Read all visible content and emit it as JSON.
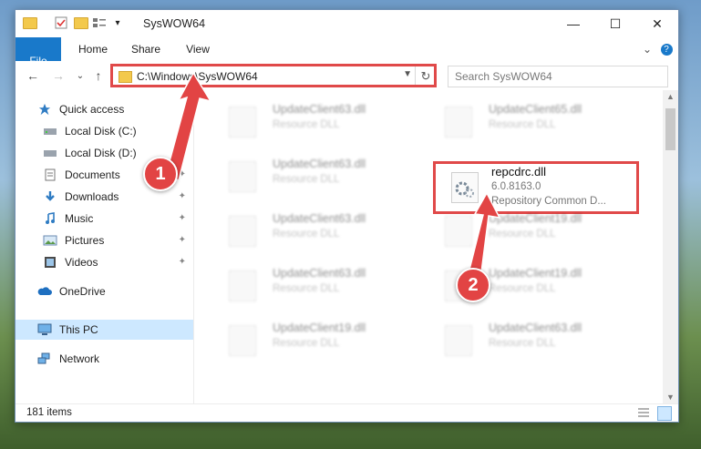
{
  "window": {
    "title": "SysWOW64",
    "minimize_glyph": "—",
    "maximize_glyph": "☐",
    "close_glyph": "✕"
  },
  "ribbon": {
    "tabs": [
      "File",
      "Home",
      "Share",
      "View"
    ],
    "expand_glyph": "⌄",
    "help_glyph": "?"
  },
  "navbar": {
    "back_glyph": "←",
    "forward_glyph": "→",
    "recent_glyph": "⌄",
    "up_glyph": "↑",
    "address": "C:\\Windows\\SysWOW64",
    "refresh_glyph": "↻",
    "search_placeholder": "Search SysWOW64"
  },
  "sidebar": {
    "items": [
      {
        "label": "Quick access",
        "icon": "star-icon",
        "pinned": false
      },
      {
        "label": "Local Disk (C:)",
        "icon": "drive-icon",
        "pinned": true
      },
      {
        "label": "Local Disk (D:)",
        "icon": "drive-icon",
        "pinned": true
      },
      {
        "label": "Documents",
        "icon": "documents-icon",
        "pinned": true
      },
      {
        "label": "Downloads",
        "icon": "downloads-icon",
        "pinned": true
      },
      {
        "label": "Music",
        "icon": "music-icon",
        "pinned": true
      },
      {
        "label": "Pictures",
        "icon": "pictures-icon",
        "pinned": true
      },
      {
        "label": "Videos",
        "icon": "videos-icon",
        "pinned": true
      },
      {
        "label": "OneDrive",
        "icon": "cloud-icon",
        "pinned": false
      },
      {
        "label": "This PC",
        "icon": "computer-icon",
        "pinned": false,
        "selected": true
      },
      {
        "label": "Network",
        "icon": "network-icon",
        "pinned": false
      }
    ],
    "pin_glyph": "📌"
  },
  "files": {
    "highlighted": {
      "name": "repcdrc.dll",
      "version": "6.0.8163.0",
      "description": "Repository Common D..."
    },
    "blurred": [
      {
        "name": "UpdateClient63.dll",
        "description": "Resource DLL"
      },
      {
        "name": "UpdateClient65.dll",
        "description": "Resource DLL"
      },
      {
        "name": "UpdateClient63.dll",
        "description": "Resource DLL"
      },
      {
        "name": "UpdateClient63.dll",
        "description": "Resource DLL"
      },
      {
        "name": "UpdateClient19.dll",
        "description": "Resource DLL"
      },
      {
        "name": "UpdateClient63.dll",
        "description": "Resource DLL"
      },
      {
        "name": "UpdateClient19.dll",
        "description": "Resource DLL"
      },
      {
        "name": "UpdateClient19.dll",
        "description": "Resource DLL"
      },
      {
        "name": "UpdateClient63.dll",
        "description": "Resource DLL"
      }
    ]
  },
  "status": {
    "item_count": "181 items"
  },
  "callouts": {
    "first": "1",
    "second": "2"
  },
  "colors": {
    "accent": "#1979ca",
    "highlight": "#e04949",
    "selection": "#cde8ff"
  }
}
